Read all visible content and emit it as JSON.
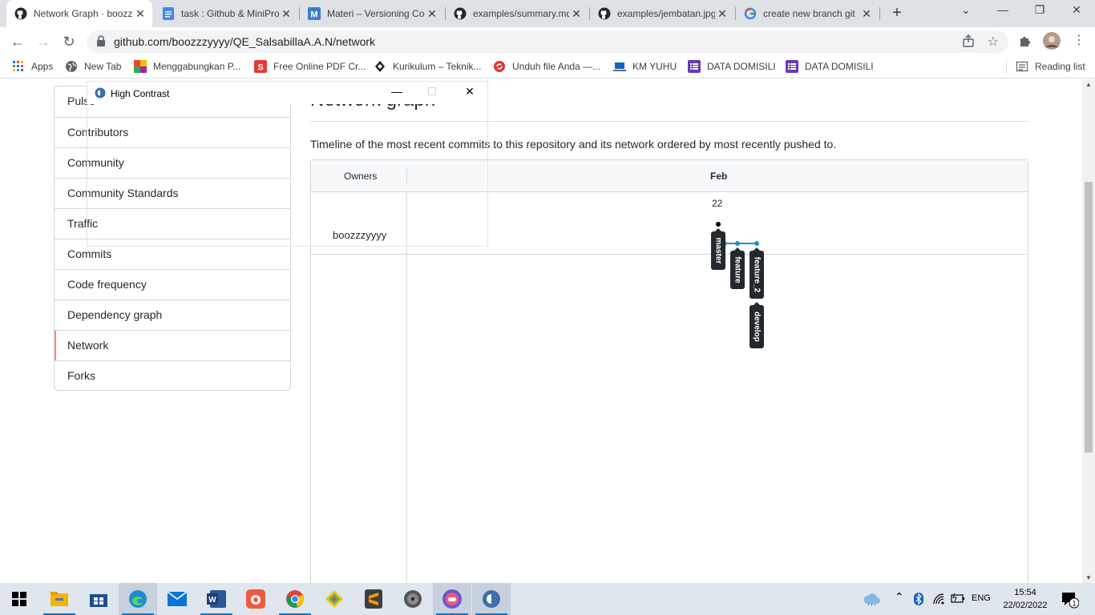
{
  "browser": {
    "tabs": [
      {
        "title": "Network Graph · boozzzyyyy/QE_SalsabillaA.A.N",
        "icon": "github-icon",
        "active": true
      },
      {
        "title": "task : Github & MiniProject",
        "icon": "google-docs-icon",
        "active": false
      },
      {
        "title": "Materi – Versioning Code",
        "icon": "m-icon",
        "active": false
      },
      {
        "title": "examples/summary.md",
        "icon": "github-icon",
        "active": false
      },
      {
        "title": "examples/jembatan.jpg",
        "icon": "github-icon",
        "active": false
      },
      {
        "title": "create new branch git",
        "icon": "google-icon",
        "active": false
      }
    ],
    "new_tab_label": "+",
    "url": "github.com/boozzzyyyy/QE_SalsabillaA.A.N/network"
  },
  "bookmarks": {
    "items": [
      {
        "label": "Apps",
        "icon": "apps-grid-icon"
      },
      {
        "label": "New Tab",
        "icon": "globe-icon"
      },
      {
        "label": "Menggabungkan P...",
        "icon": "color-blocks-icon"
      },
      {
        "label": "Free Online PDF Cr...",
        "icon": "s-icon"
      },
      {
        "label": "Kurikulum – Teknik...",
        "icon": "logo-icon"
      },
      {
        "label": "Unduh file Anda —...",
        "icon": "refresh-red-icon"
      },
      {
        "label": "KM YUHU",
        "icon": "laptop-icon"
      },
      {
        "label": "DATA DOMISILI",
        "icon": "forms-icon"
      },
      {
        "label": "DATA DOMISILI",
        "icon": "forms-icon"
      }
    ],
    "reading_list": "Reading list"
  },
  "sidebar": {
    "items": [
      {
        "label": "Pulse",
        "selected": false
      },
      {
        "label": "Contributors",
        "selected": false
      },
      {
        "label": "Community",
        "selected": false
      },
      {
        "label": "Community Standards",
        "selected": false
      },
      {
        "label": "Traffic",
        "selected": false
      },
      {
        "label": "Commits",
        "selected": false
      },
      {
        "label": "Code frequency",
        "selected": false
      },
      {
        "label": "Dependency graph",
        "selected": false
      },
      {
        "label": "Network",
        "selected": true
      },
      {
        "label": "Forks",
        "selected": false
      }
    ]
  },
  "main": {
    "heading": "Network graph",
    "description": "Timeline of the most recent commits to this repository and its network ordered by most recently pushed to.",
    "network": {
      "owners_label": "Owners",
      "month": "Feb",
      "day": "22",
      "owner": "boozzzyyyy",
      "branches": [
        "master",
        "feature",
        "feature_2",
        "develop"
      ],
      "colors": {
        "master": "#000000",
        "branch": "#1f8dd6",
        "label_bg": "#24292f"
      }
    }
  },
  "overlay": {
    "title": "High Contrast",
    "minimize": "—",
    "maximize": "☐",
    "close": "✕"
  },
  "taskbar": {
    "apps": [
      "start-icon",
      "file-explorer-icon",
      "store-icon",
      "edge-icon",
      "mail-icon",
      "word-icon",
      "bandicam-icon",
      "chrome-icon",
      "git-icon",
      "sublime-icon",
      "media-icon",
      "game-icon",
      "high-contrast-icon"
    ],
    "language": "ENG",
    "time": "15:54",
    "date": "22/02/2022",
    "notifications": "1"
  }
}
